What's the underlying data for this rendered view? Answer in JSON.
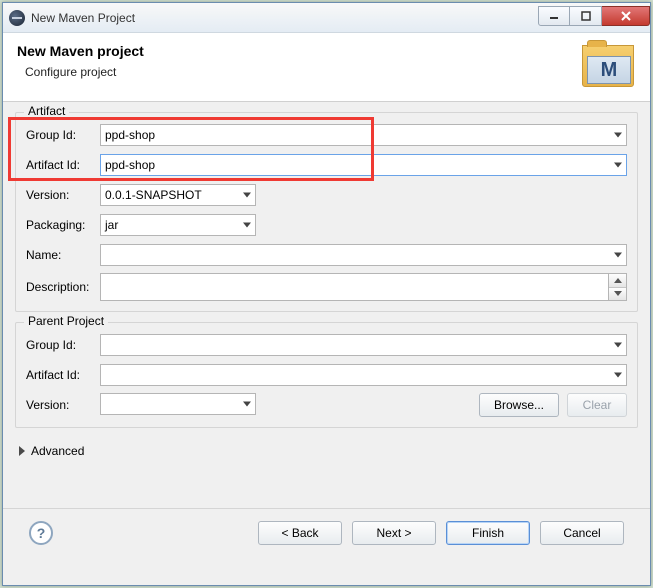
{
  "window": {
    "title": "New Maven Project"
  },
  "header": {
    "title": "New Maven project",
    "subtitle": "Configure project"
  },
  "artifact": {
    "legend": "Artifact",
    "group_id_label": "Group Id:",
    "group_id_value": "ppd-shop",
    "artifact_id_label": "Artifact Id:",
    "artifact_id_value": "ppd-shop",
    "version_label": "Version:",
    "version_value": "0.0.1-SNAPSHOT",
    "packaging_label": "Packaging:",
    "packaging_value": "jar",
    "name_label": "Name:",
    "name_value": "",
    "description_label": "Description:",
    "description_value": ""
  },
  "parent": {
    "legend": "Parent Project",
    "group_id_label": "Group Id:",
    "group_id_value": "",
    "artifact_id_label": "Artifact Id:",
    "artifact_id_value": "",
    "version_label": "Version:",
    "version_value": "",
    "browse_label": "Browse...",
    "clear_label": "Clear"
  },
  "advanced_label": "Advanced",
  "footer": {
    "back": "< Back",
    "next": "Next >",
    "finish": "Finish",
    "cancel": "Cancel"
  }
}
